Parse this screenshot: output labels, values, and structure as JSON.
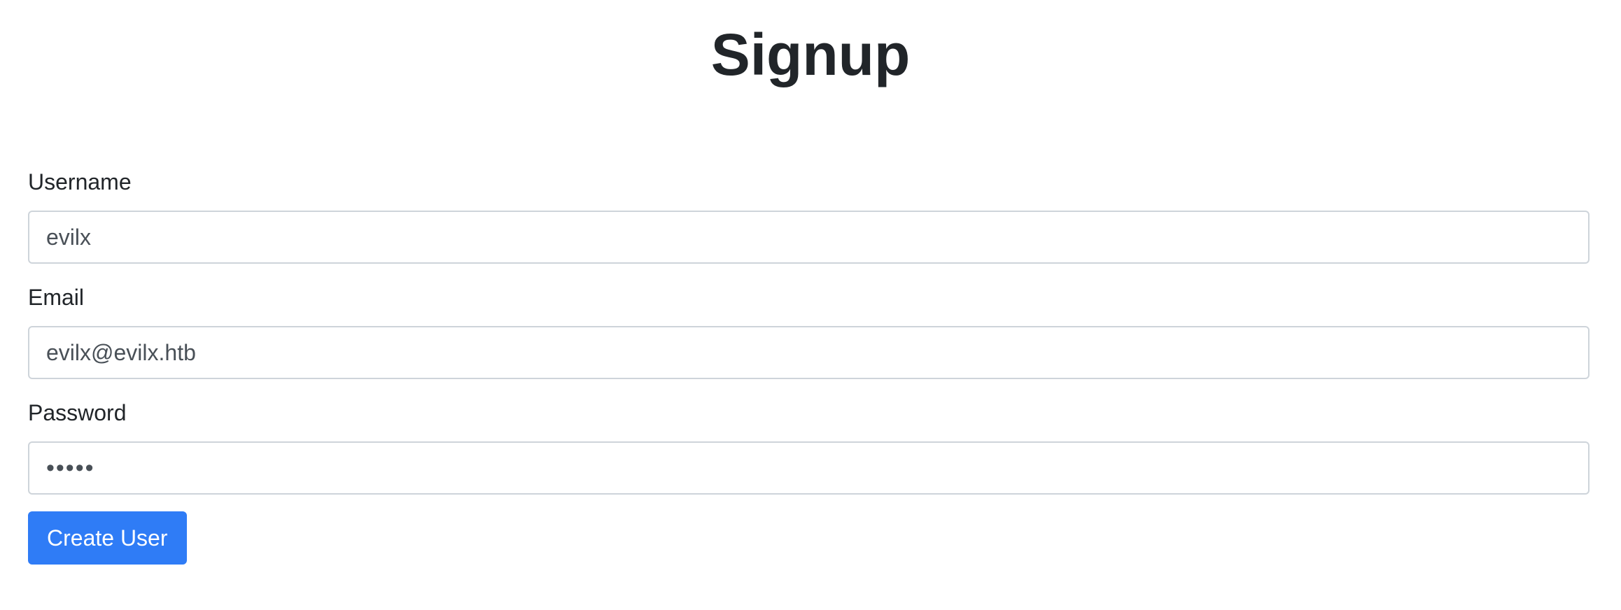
{
  "page": {
    "title": "Signup"
  },
  "form": {
    "username": {
      "label": "Username",
      "value": "evilx"
    },
    "email": {
      "label": "Email",
      "value": "evilx@evilx.htb"
    },
    "password": {
      "label": "Password",
      "value": "evilx"
    },
    "submit_label": "Create User"
  },
  "colors": {
    "primary_button": "#2f7cf6",
    "input_border": "#ced4da",
    "text": "#212529"
  }
}
